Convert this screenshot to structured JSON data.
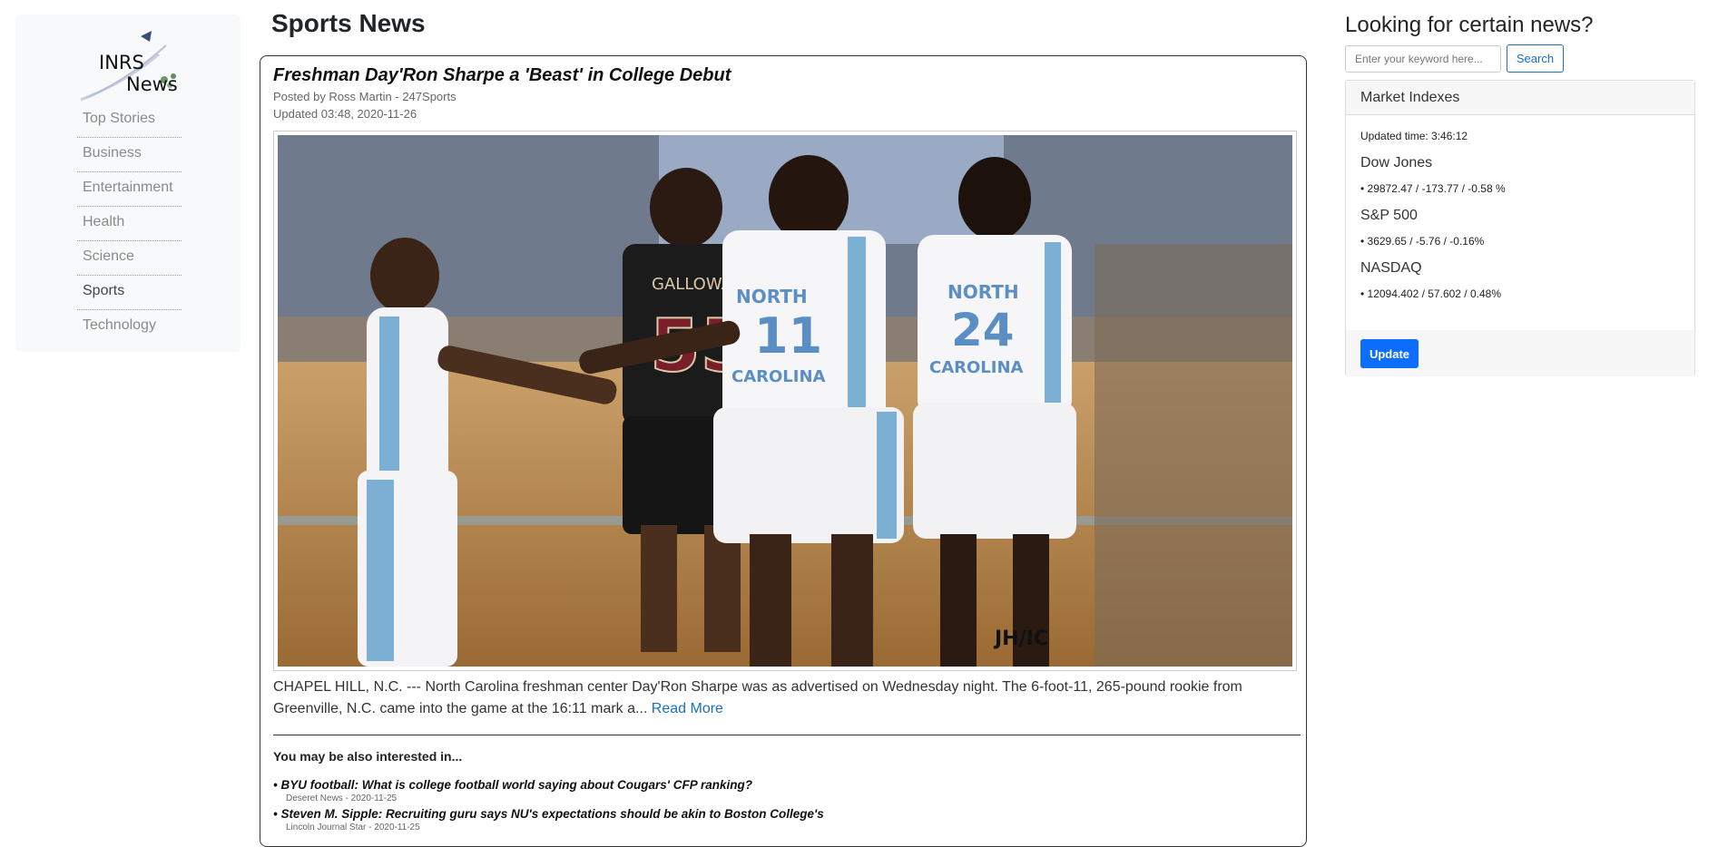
{
  "logo": {
    "line1": "INRS",
    "line2": "News"
  },
  "nav": {
    "items": [
      {
        "label": "Top Stories"
      },
      {
        "label": "Business"
      },
      {
        "label": "Entertainment"
      },
      {
        "label": "Health"
      },
      {
        "label": "Science"
      },
      {
        "label": "Sports"
      },
      {
        "label": "Technology"
      }
    ],
    "active": "Sports"
  },
  "page": {
    "title": "Sports News"
  },
  "article": {
    "headline": "Freshman Day'Ron Sharpe a 'Beast' in College Debut",
    "byline": "Posted by Ross Martin - 247Sports",
    "updated": "Updated 03:48, 2020-11-26",
    "image_credit": "JH/IC",
    "summary": "CHAPEL HILL, N.C. ---  North Carolina freshman center Day'Ron Sharpe was as advertised on Wednesday night. The 6-foot-11, 265-pound rookie from Greenville, N.C. came into the game at the 16:11 mark a...",
    "read_more": "Read More",
    "jerseys": {
      "left_name": "GALLOWAY",
      "left_number": "55",
      "center_team": "NORTH CAROLINA",
      "center_number": "11",
      "right_number": "24"
    }
  },
  "related": {
    "title": "You may be also interested in...",
    "items": [
      {
        "title": "• BYU football: What is college football world saying about Cougars' CFP ranking?",
        "meta": "Deseret News - 2020-11-25"
      },
      {
        "title": "• Steven M. Sipple: Recruiting guru says NU's expectations should be akin to Boston College's",
        "meta": "Lincoln Journal Star - 2020-11-25"
      }
    ]
  },
  "search": {
    "title": "Looking for certain news?",
    "placeholder": "Enter your keyword here...",
    "button": "Search"
  },
  "market": {
    "header": "Market Indexes",
    "updated": "Updated time: 3:46:12",
    "indexes": [
      {
        "name": "Dow Jones",
        "value": "• 29872.47 / -173.77 / -0.58 %"
      },
      {
        "name": "S&P 500",
        "value": "• 3629.65 / -5.76 / -0.16%"
      },
      {
        "name": "NASDAQ",
        "value": "• 12094.402 / 57.602 / 0.48%"
      }
    ],
    "update_button": "Update"
  },
  "colors": {
    "accent": "#0d6efd",
    "link": "#1a6fc4",
    "carolina_blue": "#7bafd4"
  }
}
